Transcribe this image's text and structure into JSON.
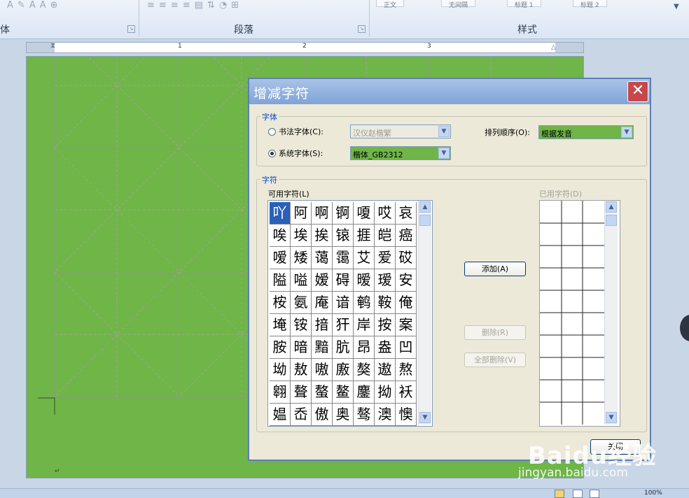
{
  "ribbon": {
    "groups": [
      {
        "label": "体"
      },
      {
        "label": "段落"
      },
      {
        "label": "样式"
      }
    ],
    "style_gallery": [
      "正文",
      "无间隔",
      "标题 1",
      "标题 2"
    ]
  },
  "ruler": {
    "numbers": [
      "1",
      "2",
      "3"
    ]
  },
  "dialog": {
    "title": "增减字符",
    "font_group": {
      "label": "字体",
      "calligraphy_option": "书法字体(C):",
      "calligraphy_value": "汉仪赵楷繁",
      "system_option": "系统字体(S):",
      "system_value": "楷体_GB2312",
      "sort_label": "排列顺序(O):",
      "sort_value": "根据发音"
    },
    "char_group": {
      "label": "字符",
      "available_label": "可用字符(L)",
      "used_label": "已用字符(D)",
      "available_chars": [
        "吖",
        "阿",
        "啊",
        "锕",
        "嗄",
        "哎",
        "哀",
        "唉",
        "埃",
        "挨",
        "锿",
        "捱",
        "皑",
        "癌",
        "嗳",
        "矮",
        "蔼",
        "霭",
        "艾",
        "爱",
        "砹",
        "隘",
        "嗌",
        "嫒",
        "碍",
        "暧",
        "瑷",
        "安",
        "桉",
        "氨",
        "庵",
        "谙",
        "鹌",
        "鞍",
        "俺",
        "埯",
        "铵",
        "揞",
        "犴",
        "岸",
        "按",
        "案",
        "胺",
        "暗",
        "黯",
        "肮",
        "昂",
        "盎",
        "凹",
        "坳",
        "敖",
        "嗷",
        "廒",
        "獒",
        "遨",
        "熬",
        "翱",
        "聱",
        "螯",
        "鳌",
        "鏖",
        "拗",
        "袄",
        "媪",
        "岙",
        "傲",
        "奥",
        "骜",
        "澳",
        "懊"
      ],
      "add_button": "添加(A)",
      "delete_button": "删除(R)",
      "delete_all_button": "全部删除(V)"
    },
    "close_button": "关闭"
  },
  "watermark": {
    "logo": "Baidu经验",
    "url": "jingyan.baidu.com"
  },
  "status_bar": {
    "zoom": "100%"
  }
}
